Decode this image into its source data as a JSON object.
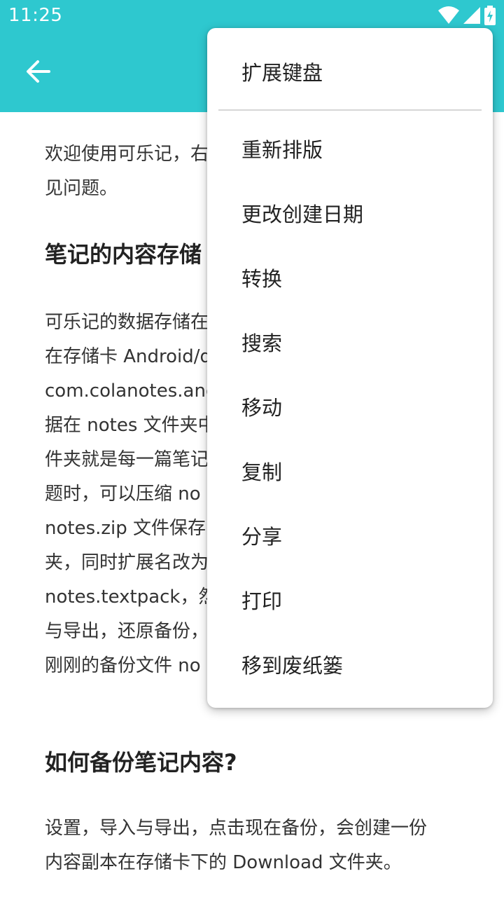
{
  "status_bar": {
    "time": "11:25",
    "icons": [
      "wifi-icon",
      "signal-icon",
      "battery-charging-icon"
    ]
  },
  "app_bar": {
    "color": "#2EC8CF",
    "back_icon": "arrow-left-icon"
  },
  "article": {
    "intro": [
      "欢迎使用可乐记，右",
      "见问题。"
    ],
    "heading1": "笔记的内容存储",
    "para1": [
      "可乐记的数据存储在",
      "在存储卡 Android/d",
      "com.colanotes.and",
      "据在 notes 文件夹中",
      "件夹就是每一篇笔记",
      "题时，可以压缩 no",
      "notes.zip 文件保存",
      "夹，同时扩展名改为",
      "notes.textpack，然",
      "与导出，还原备份，",
      "刚刚的备份文件 no"
    ],
    "heading2": "如何备份笔记内容?",
    "para2": [
      "设置，导入与导出，点击现在备份，会创建一份",
      "内容副本在存储卡下的 Download 文件夹。"
    ]
  },
  "menu": {
    "items": [
      "扩展键盘",
      "重新排版",
      "更改创建日期",
      "转换",
      "搜索",
      "移动",
      "复制",
      "分享",
      "打印",
      "移到废纸篓"
    ]
  }
}
